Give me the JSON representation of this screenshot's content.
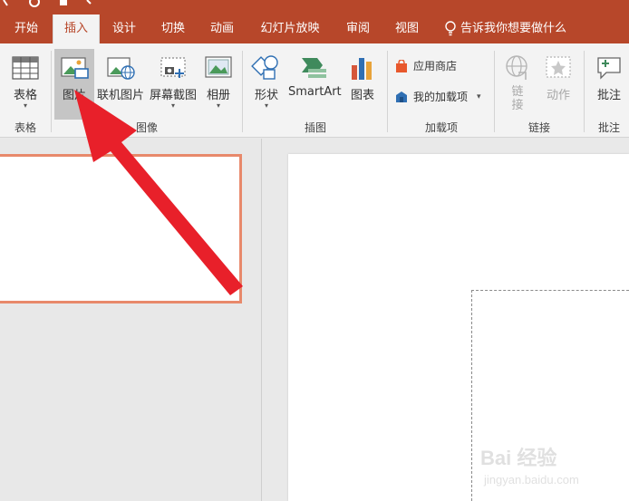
{
  "tabs": [
    "开始",
    "插入",
    "设计",
    "切换",
    "动画",
    "幻灯片放映",
    "审阅",
    "视图"
  ],
  "tell_me": "告诉我你想要做什么",
  "ribbon": {
    "table": {
      "label": "表格",
      "group": "表格"
    },
    "images": {
      "picture": "图片",
      "online_picture": "联机图片",
      "screenshot": "屏幕截图",
      "album": "相册",
      "group": "图像"
    },
    "illustrations": {
      "shapes": "形状",
      "smartart": "SmartArt",
      "chart": "图表",
      "group": "插图"
    },
    "addins": {
      "store": "应用商店",
      "my_addins": "我的加载项",
      "group": "加载项"
    },
    "links": {
      "link": "链接",
      "action": "动作",
      "group": "链接"
    },
    "comments": {
      "comment": "批注",
      "group": "批注"
    }
  },
  "watermark": {
    "brand": "Bai 经验",
    "url": "jingyan.baidu.com"
  },
  "colors": {
    "accent": "#b7472a",
    "arrow": "#e8202a",
    "thumb_border": "#e8896b"
  }
}
